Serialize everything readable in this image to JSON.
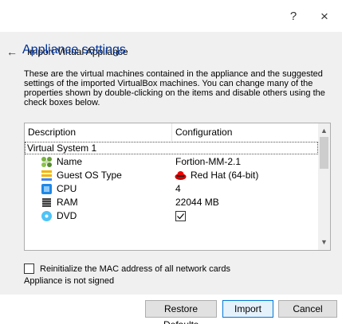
{
  "window": {
    "help_glyph": "?",
    "close_glyph": "×"
  },
  "wizard": {
    "back_glyph": "←",
    "title": "Import Virtual Appliance"
  },
  "page": {
    "title": "Appliance settings",
    "description": "These are the virtual machines contained in the appliance and the suggested settings of the imported VirtualBox machines. You can change many of the properties shown by double-clicking on the items and disable others using the check boxes below."
  },
  "table": {
    "columns": [
      "Description",
      "Configuration"
    ],
    "group": "Virtual System 1",
    "rows": [
      {
        "icon": "name-icon",
        "label": "Name",
        "value": "Fortion-MM-2.1"
      },
      {
        "icon": "os-type-icon",
        "label": "Guest OS Type",
        "value": "Red Hat (64-bit)",
        "value_icon": "redhat-icon"
      },
      {
        "icon": "cpu-icon",
        "label": "CPU",
        "value": "4"
      },
      {
        "icon": "ram-icon",
        "label": "RAM",
        "value": "22044 MB"
      },
      {
        "icon": "dvd-icon",
        "label": "DVD",
        "value_checked": true
      }
    ]
  },
  "options": {
    "mac_label": "Reinitialize the MAC address of all network cards",
    "mac_checked": false
  },
  "status": {
    "signed": "Appliance is not signed"
  },
  "buttons": {
    "restore": "Restore Defaults",
    "import": "Import",
    "cancel": "Cancel"
  }
}
